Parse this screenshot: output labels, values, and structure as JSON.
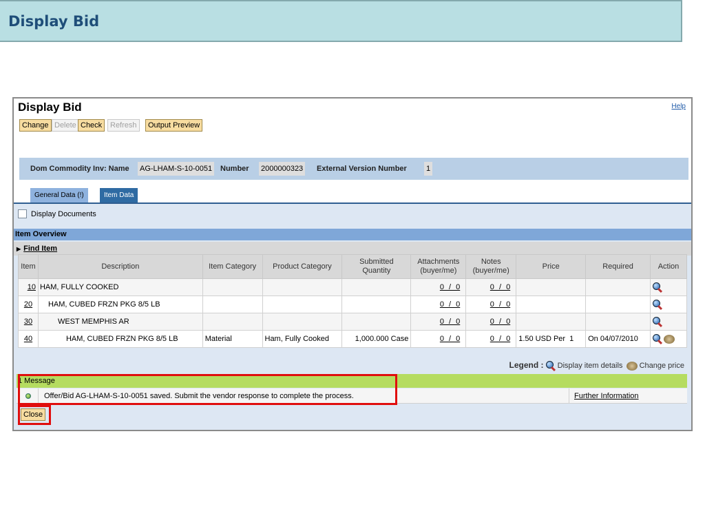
{
  "banner": {
    "title": "Display Bid"
  },
  "panel": {
    "title": "Display Bid",
    "help": "Help"
  },
  "toolbar": {
    "change": "Change",
    "delete": "Delete",
    "check": "Check",
    "refresh": "Refresh",
    "output_preview": "Output Preview"
  },
  "header": {
    "name_label": "Dom Commodity Inv: Name",
    "name_value": "AG-LHAM-S-10-0051",
    "number_label": "Number",
    "number_value": "2000000323",
    "ext_label": "External Version Number",
    "ext_value": "1"
  },
  "tabs": [
    {
      "label": "General Data (!)"
    },
    {
      "label": "Item Data",
      "active": true
    }
  ],
  "display_documents": "Display Documents",
  "item_overview": "Item Overview",
  "find_item": "Find Item",
  "table": {
    "headers": [
      "Item",
      "Description",
      "Item Category",
      "Product Category",
      "Submitted Quantity",
      "Attachments (buyer/me)",
      "Notes (buyer/me)",
      "Price",
      "Required",
      "Action"
    ],
    "rows": [
      {
        "item": "10",
        "desc": "HAM, FULLY COOKED",
        "icat": "",
        "pcat": "",
        "qty": "",
        "att": "0 / 0",
        "notes": "0 / 0",
        "price": "",
        "req": ""
      },
      {
        "item": "20",
        "desc": "HAM, CUBED FRZN PKG 8/5 LB",
        "icat": "",
        "pcat": "",
        "qty": "",
        "att": "0 / 0",
        "notes": "0 / 0",
        "price": "",
        "req": ""
      },
      {
        "item": "30",
        "desc": "WEST MEMPHIS AR",
        "icat": "",
        "pcat": "",
        "qty": "",
        "att": "0 / 0",
        "notes": "0 / 0",
        "price": "",
        "req": ""
      },
      {
        "item": "40",
        "desc": "HAM, CUBED FRZN PKG 8/5 LB",
        "icat": "Material",
        "pcat": "Ham, Fully Cooked",
        "qty": "1,000.000 Case",
        "att": "0 / 0",
        "notes": "0 / 0",
        "price": "1.50 USD Per  1",
        "req": "On 04/07/2010"
      }
    ]
  },
  "legend": {
    "label": "Legend :",
    "display": "Display item details",
    "change": "Change price"
  },
  "messages": {
    "count": "1 Message",
    "text": "Offer/Bid AG-LHAM-S-10-0051 saved. Submit the vendor response to complete the process.",
    "further": "Further Information"
  },
  "close": "Close",
  "colors": {
    "highlight": "#e00d0d",
    "message_bar": "#b5dc60"
  }
}
